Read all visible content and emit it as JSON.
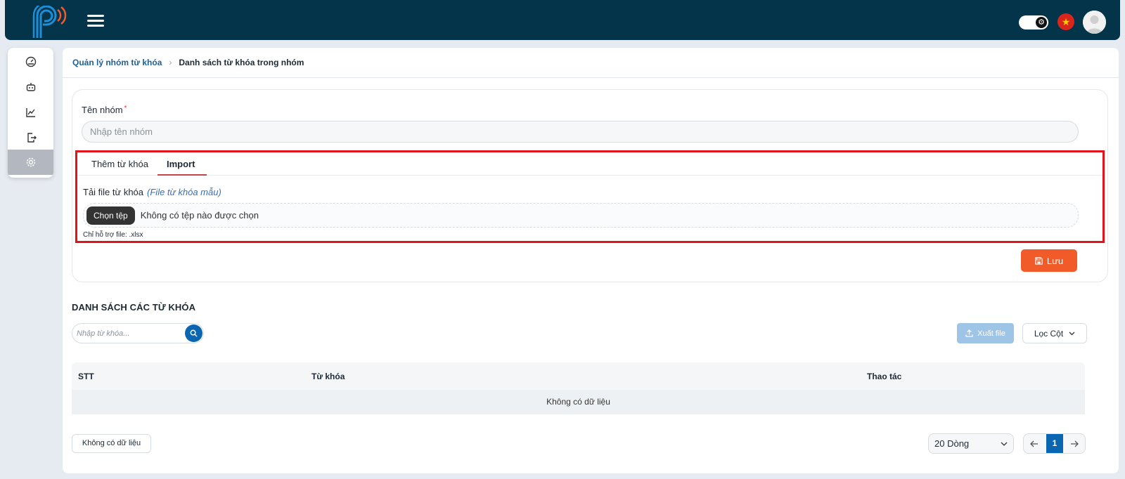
{
  "header": {
    "logo_icon": "logo-p-signal-icon",
    "menu_icon": "hamburger-icon",
    "theme_toggle_icon": "gear-icon",
    "flag_icon": "vietnam-flag-icon",
    "avatar_icon": "user-avatar-icon"
  },
  "sidebar": {
    "items": [
      {
        "icon": "dashboard-icon"
      },
      {
        "icon": "robot-icon"
      },
      {
        "icon": "chart-line-icon"
      },
      {
        "icon": "export-file-icon"
      },
      {
        "icon": "gear-icon",
        "active": true
      }
    ]
  },
  "breadcrumb": {
    "parent": "Quản lý nhóm từ khóa",
    "current": "Danh sách từ khóa trong nhóm"
  },
  "form": {
    "name_label": "Tên nhóm",
    "required_mark": "*",
    "name_placeholder": "Nhập tên nhóm",
    "name_value": "",
    "tabs": [
      {
        "label": "Thêm từ khóa"
      },
      {
        "label": "Import",
        "active": true
      }
    ],
    "upload_label": "Tải file từ khóa",
    "sample_link": "(File từ khóa mẫu)",
    "choose_file_button": "Chọn tệp",
    "no_file_text": "Không có tệp nào được chọn",
    "support_note": "Chỉ hỗ trợ file: .xlsx",
    "save_button": "Lưu"
  },
  "list": {
    "title": "DANH SÁCH CÁC TỪ KHÓA",
    "search_placeholder": "Nhập từ khóa...",
    "export_button": "Xuất file",
    "filter_button": "Lọc Cột",
    "columns": [
      "STT",
      "Từ khóa",
      "Thao tác"
    ],
    "empty_text": "Không có dữ liệu",
    "footer_count": "Không có dữ liệu",
    "page_size": "20 Dòng",
    "current_page": "1"
  },
  "colors": {
    "header_bg": "#03344a",
    "accent_orange": "#f15a29",
    "primary_blue": "#0b66b1",
    "highlight_red": "#e1141b"
  }
}
